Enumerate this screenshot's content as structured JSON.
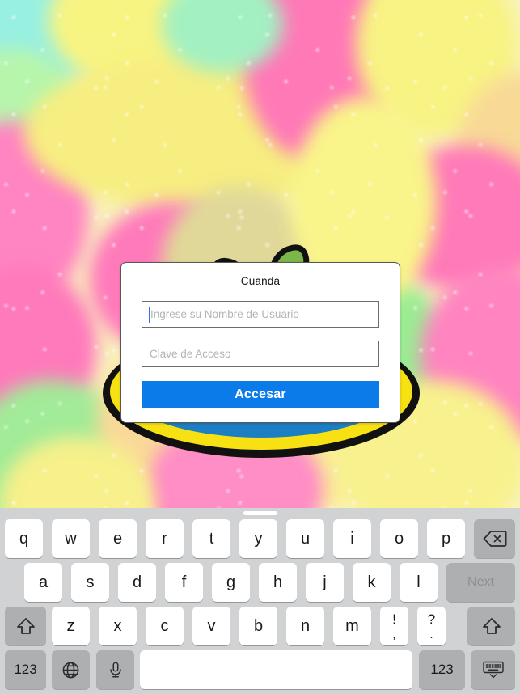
{
  "wallpaper": {
    "description": "blurred-sour-gummy-worms-photo",
    "colors": [
      "#f2e94a",
      "#ff3fa0",
      "#5ee35a",
      "#f7c45e",
      "#5fe8d2",
      "#ff6ec7"
    ]
  },
  "logo": {
    "name": "green-gummy-worm-mascot-logo",
    "outline_color": "#111111",
    "worm_color": "#7ab648",
    "ring_color": "#f7e112",
    "disc_color": "#1c7fc4"
  },
  "dialog": {
    "title": "Cuanda",
    "username": {
      "placeholder": "Ingrese su Nombre de Usuario",
      "value": ""
    },
    "password": {
      "placeholder": "Clave de Acceso",
      "value": ""
    },
    "submit_label": "Accesar",
    "accent_color": "#0b7bea",
    "caret_color": "#3b6ef0"
  },
  "keyboard": {
    "layout": "ios-ipad-qwerty",
    "return_key_label": "Next",
    "row1": [
      {
        "label": "q",
        "name": "key-q"
      },
      {
        "label": "w",
        "name": "key-w"
      },
      {
        "label": "e",
        "name": "key-e"
      },
      {
        "label": "r",
        "name": "key-r"
      },
      {
        "label": "t",
        "name": "key-t"
      },
      {
        "label": "y",
        "name": "key-y"
      },
      {
        "label": "u",
        "name": "key-u"
      },
      {
        "label": "i",
        "name": "key-i"
      },
      {
        "label": "o",
        "name": "key-o"
      },
      {
        "label": "p",
        "name": "key-p"
      }
    ],
    "row2": [
      {
        "label": "a",
        "name": "key-a"
      },
      {
        "label": "s",
        "name": "key-s"
      },
      {
        "label": "d",
        "name": "key-d"
      },
      {
        "label": "f",
        "name": "key-f"
      },
      {
        "label": "g",
        "name": "key-g"
      },
      {
        "label": "h",
        "name": "key-h"
      },
      {
        "label": "j",
        "name": "key-j"
      },
      {
        "label": "k",
        "name": "key-k"
      },
      {
        "label": "l",
        "name": "key-l"
      }
    ],
    "row3": [
      {
        "label": "z",
        "name": "key-z"
      },
      {
        "label": "x",
        "name": "key-x"
      },
      {
        "label": "c",
        "name": "key-c"
      },
      {
        "label": "v",
        "name": "key-v"
      },
      {
        "label": "b",
        "name": "key-b"
      },
      {
        "label": "n",
        "name": "key-n"
      },
      {
        "label": "m",
        "name": "key-m"
      }
    ],
    "punctuation": [
      {
        "top": "!",
        "bottom": ",",
        "name": "key-exclamation-comma"
      },
      {
        "top": "?",
        "bottom": ".",
        "name": "key-question-period"
      }
    ],
    "numeric_left_label": "123",
    "numeric_right_label": "123",
    "icons": {
      "backspace": "backspace-icon",
      "shift_left": "shift-icon",
      "shift_right": "shift-icon",
      "globe": "globe-icon",
      "dictation": "microphone-icon",
      "dismiss": "hide-keyboard-icon"
    },
    "spacebar_label": ""
  }
}
